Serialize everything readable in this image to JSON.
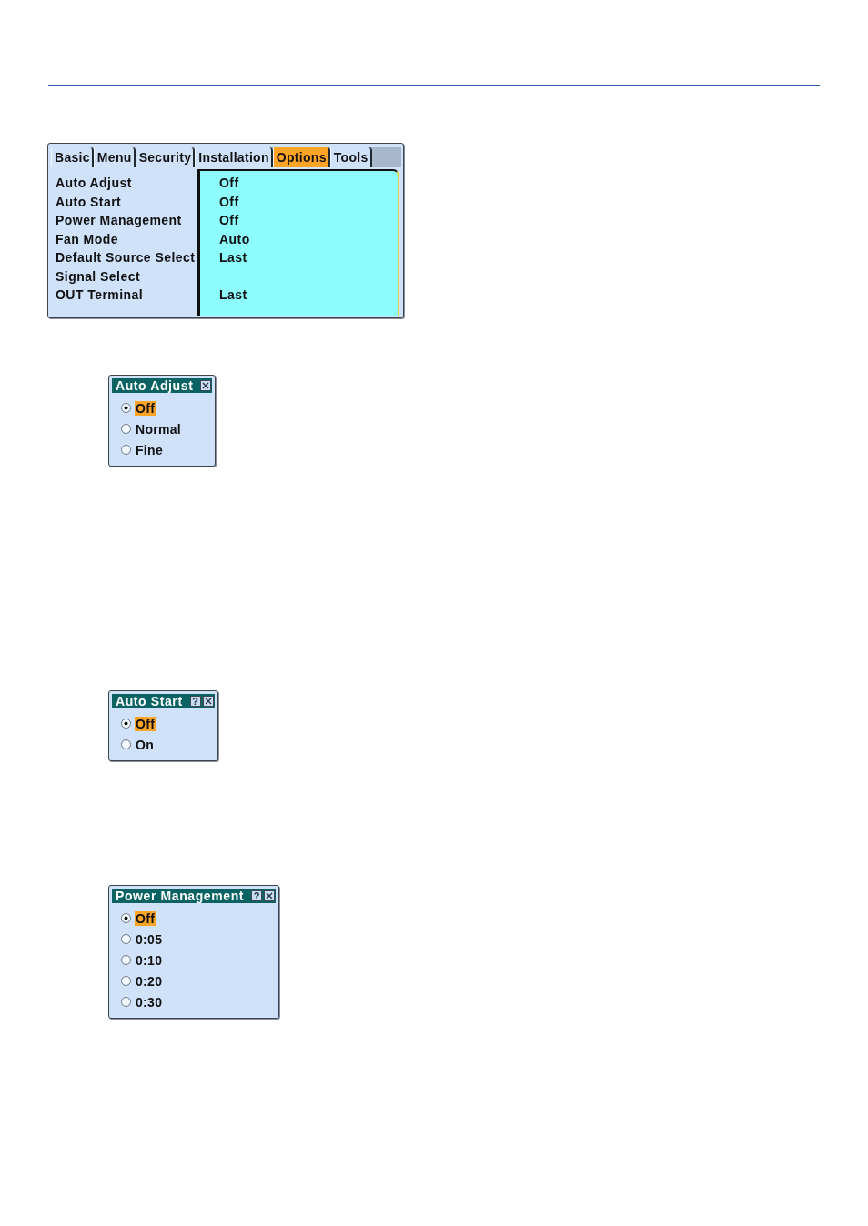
{
  "tabs": [
    {
      "label": "Basic",
      "selected": false
    },
    {
      "label": "Menu",
      "selected": false
    },
    {
      "label": "Security",
      "selected": false
    },
    {
      "label": "Installation",
      "selected": false
    },
    {
      "label": "Options",
      "selected": true
    },
    {
      "label": "Tools",
      "selected": false
    }
  ],
  "settings": [
    {
      "label": "Auto Adjust",
      "value": "Off"
    },
    {
      "label": "Auto Start",
      "value": "Off"
    },
    {
      "label": "Power Management",
      "value": "Off"
    },
    {
      "label": "Fan Mode",
      "value": "Auto"
    },
    {
      "label": "Default Source Select",
      "value": "Last"
    },
    {
      "label": "Signal Select"
    },
    {
      "label": "OUT Terminal",
      "value": "Last"
    }
  ],
  "dialogs": [
    {
      "title": "Auto Adjust",
      "options": [
        {
          "label": "Off",
          "selected": true
        },
        {
          "label": "Normal",
          "selected": false
        },
        {
          "label": "Fine",
          "selected": false
        }
      ]
    },
    {
      "title": "Auto Start",
      "help_button": "?",
      "options": [
        {
          "label": "Off",
          "selected": true
        },
        {
          "label": "On",
          "selected": false
        }
      ]
    },
    {
      "title": "Power Management",
      "help_button": "?",
      "options": [
        {
          "label": "Off",
          "selected": true
        },
        {
          "label": "0:05",
          "selected": false
        },
        {
          "label": "0:10",
          "selected": false
        },
        {
          "label": "0:20",
          "selected": false
        },
        {
          "label": "0:30",
          "selected": false
        }
      ]
    }
  ]
}
